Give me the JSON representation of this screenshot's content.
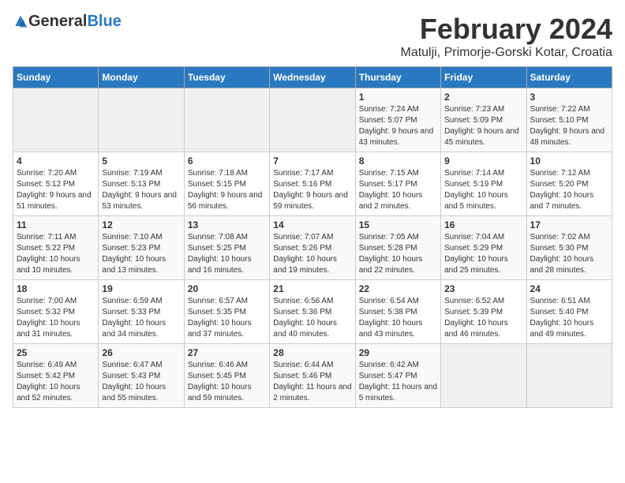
{
  "header": {
    "logo_general": "General",
    "logo_blue": "Blue",
    "month_year": "February 2024",
    "location": "Matulji, Primorje-Gorski Kotar, Croatia"
  },
  "weekdays": [
    "Sunday",
    "Monday",
    "Tuesday",
    "Wednesday",
    "Thursday",
    "Friday",
    "Saturday"
  ],
  "weeks": [
    [
      {
        "day": "",
        "sunrise": "",
        "sunset": "",
        "daylight": ""
      },
      {
        "day": "",
        "sunrise": "",
        "sunset": "",
        "daylight": ""
      },
      {
        "day": "",
        "sunrise": "",
        "sunset": "",
        "daylight": ""
      },
      {
        "day": "",
        "sunrise": "",
        "sunset": "",
        "daylight": ""
      },
      {
        "day": "1",
        "sunrise": "Sunrise: 7:24 AM",
        "sunset": "Sunset: 5:07 PM",
        "daylight": "Daylight: 9 hours and 43 minutes."
      },
      {
        "day": "2",
        "sunrise": "Sunrise: 7:23 AM",
        "sunset": "Sunset: 5:09 PM",
        "daylight": "Daylight: 9 hours and 45 minutes."
      },
      {
        "day": "3",
        "sunrise": "Sunrise: 7:22 AM",
        "sunset": "Sunset: 5:10 PM",
        "daylight": "Daylight: 9 hours and 48 minutes."
      }
    ],
    [
      {
        "day": "4",
        "sunrise": "Sunrise: 7:20 AM",
        "sunset": "Sunset: 5:12 PM",
        "daylight": "Daylight: 9 hours and 51 minutes."
      },
      {
        "day": "5",
        "sunrise": "Sunrise: 7:19 AM",
        "sunset": "Sunset: 5:13 PM",
        "daylight": "Daylight: 9 hours and 53 minutes."
      },
      {
        "day": "6",
        "sunrise": "Sunrise: 7:18 AM",
        "sunset": "Sunset: 5:15 PM",
        "daylight": "Daylight: 9 hours and 56 minutes."
      },
      {
        "day": "7",
        "sunrise": "Sunrise: 7:17 AM",
        "sunset": "Sunset: 5:16 PM",
        "daylight": "Daylight: 9 hours and 59 minutes."
      },
      {
        "day": "8",
        "sunrise": "Sunrise: 7:15 AM",
        "sunset": "Sunset: 5:17 PM",
        "daylight": "Daylight: 10 hours and 2 minutes."
      },
      {
        "day": "9",
        "sunrise": "Sunrise: 7:14 AM",
        "sunset": "Sunset: 5:19 PM",
        "daylight": "Daylight: 10 hours and 5 minutes."
      },
      {
        "day": "10",
        "sunrise": "Sunrise: 7:12 AM",
        "sunset": "Sunset: 5:20 PM",
        "daylight": "Daylight: 10 hours and 7 minutes."
      }
    ],
    [
      {
        "day": "11",
        "sunrise": "Sunrise: 7:11 AM",
        "sunset": "Sunset: 5:22 PM",
        "daylight": "Daylight: 10 hours and 10 minutes."
      },
      {
        "day": "12",
        "sunrise": "Sunrise: 7:10 AM",
        "sunset": "Sunset: 5:23 PM",
        "daylight": "Daylight: 10 hours and 13 minutes."
      },
      {
        "day": "13",
        "sunrise": "Sunrise: 7:08 AM",
        "sunset": "Sunset: 5:25 PM",
        "daylight": "Daylight: 10 hours and 16 minutes."
      },
      {
        "day": "14",
        "sunrise": "Sunrise: 7:07 AM",
        "sunset": "Sunset: 5:26 PM",
        "daylight": "Daylight: 10 hours and 19 minutes."
      },
      {
        "day": "15",
        "sunrise": "Sunrise: 7:05 AM",
        "sunset": "Sunset: 5:28 PM",
        "daylight": "Daylight: 10 hours and 22 minutes."
      },
      {
        "day": "16",
        "sunrise": "Sunrise: 7:04 AM",
        "sunset": "Sunset: 5:29 PM",
        "daylight": "Daylight: 10 hours and 25 minutes."
      },
      {
        "day": "17",
        "sunrise": "Sunrise: 7:02 AM",
        "sunset": "Sunset: 5:30 PM",
        "daylight": "Daylight: 10 hours and 28 minutes."
      }
    ],
    [
      {
        "day": "18",
        "sunrise": "Sunrise: 7:00 AM",
        "sunset": "Sunset: 5:32 PM",
        "daylight": "Daylight: 10 hours and 31 minutes."
      },
      {
        "day": "19",
        "sunrise": "Sunrise: 6:59 AM",
        "sunset": "Sunset: 5:33 PM",
        "daylight": "Daylight: 10 hours and 34 minutes."
      },
      {
        "day": "20",
        "sunrise": "Sunrise: 6:57 AM",
        "sunset": "Sunset: 5:35 PM",
        "daylight": "Daylight: 10 hours and 37 minutes."
      },
      {
        "day": "21",
        "sunrise": "Sunrise: 6:56 AM",
        "sunset": "Sunset: 5:36 PM",
        "daylight": "Daylight: 10 hours and 40 minutes."
      },
      {
        "day": "22",
        "sunrise": "Sunrise: 6:54 AM",
        "sunset": "Sunset: 5:38 PM",
        "daylight": "Daylight: 10 hours and 43 minutes."
      },
      {
        "day": "23",
        "sunrise": "Sunrise: 6:52 AM",
        "sunset": "Sunset: 5:39 PM",
        "daylight": "Daylight: 10 hours and 46 minutes."
      },
      {
        "day": "24",
        "sunrise": "Sunrise: 6:51 AM",
        "sunset": "Sunset: 5:40 PM",
        "daylight": "Daylight: 10 hours and 49 minutes."
      }
    ],
    [
      {
        "day": "25",
        "sunrise": "Sunrise: 6:49 AM",
        "sunset": "Sunset: 5:42 PM",
        "daylight": "Daylight: 10 hours and 52 minutes."
      },
      {
        "day": "26",
        "sunrise": "Sunrise: 6:47 AM",
        "sunset": "Sunset: 5:43 PM",
        "daylight": "Daylight: 10 hours and 55 minutes."
      },
      {
        "day": "27",
        "sunrise": "Sunrise: 6:46 AM",
        "sunset": "Sunset: 5:45 PM",
        "daylight": "Daylight: 10 hours and 59 minutes."
      },
      {
        "day": "28",
        "sunrise": "Sunrise: 6:44 AM",
        "sunset": "Sunset: 5:46 PM",
        "daylight": "Daylight: 11 hours and 2 minutes."
      },
      {
        "day": "29",
        "sunrise": "Sunrise: 6:42 AM",
        "sunset": "Sunset: 5:47 PM",
        "daylight": "Daylight: 11 hours and 5 minutes."
      },
      {
        "day": "",
        "sunrise": "",
        "sunset": "",
        "daylight": ""
      },
      {
        "day": "",
        "sunrise": "",
        "sunset": "",
        "daylight": ""
      }
    ]
  ]
}
